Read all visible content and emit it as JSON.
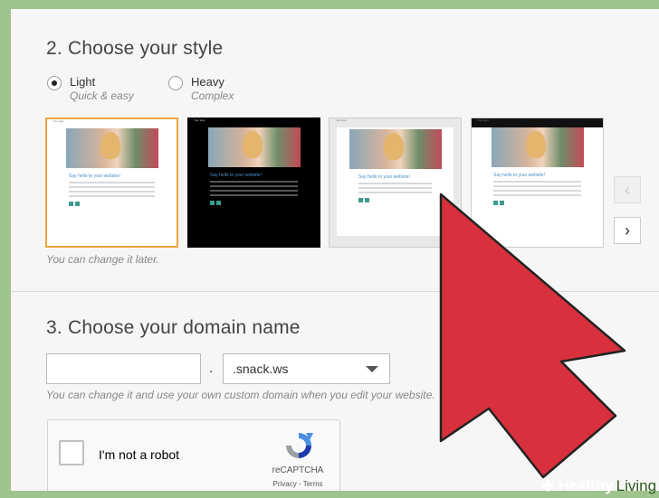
{
  "style_section": {
    "heading": "2. Choose your style",
    "options": [
      {
        "label": "Light",
        "subtitle": "Quick & easy",
        "selected": true
      },
      {
        "label": "Heavy",
        "subtitle": "Complex",
        "selected": false
      }
    ],
    "thumbnail_site_title": "Say hello to your website!",
    "thumbnail_logo_text": "Your logo",
    "caption": "You can change it later."
  },
  "domain_section": {
    "heading": "3. Choose your domain name",
    "input_value": "",
    "separator": ".",
    "selected_domain": ".snack.ws",
    "caption": "You can change it and use your own custom domain when you edit your website."
  },
  "captcha": {
    "label": "I'm not a robot",
    "brand": "reCAPTCHA",
    "links": "Privacy - Terms"
  },
  "watermark": {
    "symbol": "✚",
    "word1": "Healthy",
    "word2": "Living"
  },
  "colors": {
    "selected_border": "#f0a33c",
    "arrow_fill": "#d8303c",
    "frame": "#9fc38c"
  }
}
